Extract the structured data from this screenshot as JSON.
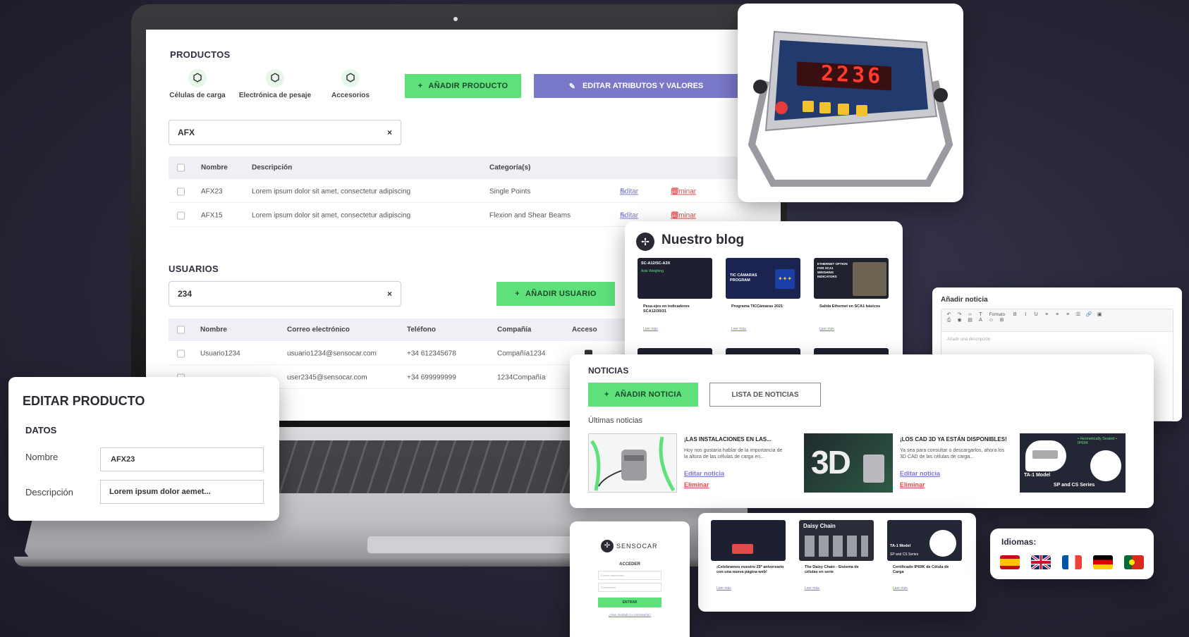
{
  "products": {
    "title": "PRODUCTOS",
    "categories": [
      "Células de carga",
      "Electrónica de pesaje",
      "Accesorios"
    ],
    "add_button": "AÑADIR PRODUCTO",
    "edit_attrs_button": "EDITAR ATRIBUTOS Y VALORES",
    "search_value": "AFX",
    "columns": [
      "Nombre",
      "Descripción",
      "Categoría(s)"
    ],
    "rows": [
      {
        "name": "AFX23",
        "description": "Lorem ipsum dolor sit amet, consectetur adipiscing",
        "category": "Single Points"
      },
      {
        "name": "AFX15",
        "description": "Lorem ipsum dolor sit amet, consectetur adipiscing",
        "category": "Flexion and Shear Beams"
      }
    ],
    "edit_label": "Editar",
    "delete_label": "Eliminar"
  },
  "users": {
    "title": "USUARIOS",
    "search_value": "234",
    "add_button": "AÑADIR USUARIO",
    "columns": [
      "Nombre",
      "Correo electrónico",
      "Teléfono",
      "Compañía",
      "Acceso"
    ],
    "rows": [
      {
        "name": "Usuario1234",
        "email": "usuario1234@sensocar.com",
        "phone": "+34 612345678",
        "company": "Compañía1234"
      },
      {
        "name": "",
        "email": "user2345@sensocar.com",
        "phone": "+34 699999999",
        "company": "1234Compañía"
      }
    ]
  },
  "edit_product": {
    "title": "EDITAR PRODUCTO",
    "section": "DATOS",
    "name_label": "Nombre",
    "name_value": "AFX23",
    "desc_label": "Descripción",
    "desc_value": "Lorem ipsum dolor aemet..."
  },
  "indicator": {
    "display": "2236"
  },
  "blog": {
    "title": "Nuestro blog",
    "posts": [
      {
        "thumb": "SC-A12/SC-A3X",
        "thumb_sub": "Axle Weighing",
        "title": "Pesa-ejes en indicadores SCA12/30/31",
        "more": "Leer más"
      },
      {
        "thumb": "TIC CÁMARAS PROGRAM",
        "title": "Programa TICCámaras 2021",
        "more": "Leer más"
      },
      {
        "thumb": "ETHERNET OPTION FOR SCA1 WEIGHING INDICATORS",
        "title": "Salida Ethernet en SCA1 básicos",
        "more": "Leer más"
      }
    ],
    "posts2": [
      {
        "thumb": "",
        "title": "¡Celebramos nuestro 25º aniversario con una nueva página web!",
        "more": "Leer más"
      },
      {
        "thumb": "Daisy Chain",
        "title": "The Daisy Chain - Sistema de células en serie",
        "more": "Leer más"
      },
      {
        "thumb": "TA-1 Model",
        "thumb_sub": "SP and CS Series",
        "title": "Certificado IP69K de Célula de Carga",
        "more": "Leer más"
      }
    ]
  },
  "add_news": {
    "title": "Añadir noticia",
    "format_label": "Formato",
    "placeholder": "Añadir una descripción"
  },
  "news": {
    "title": "NOTICIAS",
    "add_button": "AÑADIR NOTICIA",
    "list_button": "LISTA DE NOTICIAS",
    "latest_label": "Últimas noticias",
    "items": [
      {
        "title": "¡LAS INSTALACIONES EN LAS...",
        "text": "Hoy nos gustaría hablar de la importancia de la altura de las células de carga en...",
        "edit": "Editar noticia",
        "delete": "Eliminar"
      },
      {
        "title": "¡LOS CAD 3D YA ESTÁN DISPONIBLES!",
        "text": "Ya sea para consultar o descargarlos, ahora los 3D CAD de las células de carga...",
        "edit": "Editar noticia",
        "delete": "Eliminar"
      }
    ],
    "thumb2_text": "3D",
    "thumb3_model": "TA-1 Model",
    "thumb3_series": "SP and CS Series",
    "thumb3_badge": "• Hermetically Sealed • IP69K"
  },
  "login": {
    "brand": "SENSOCAR",
    "heading": "ACCEDER",
    "email_placeholder": "Correo electrónico",
    "password_placeholder": "Contraseña",
    "submit": "ENTRAR",
    "forgot": "¿Has olvidado tu contraseña?"
  },
  "languages": {
    "title": "Idiomas:",
    "flags": [
      "es-flag",
      "uk-flag",
      "fr-flag",
      "de-flag",
      "pt-flag"
    ]
  },
  "colors": {
    "accent_green": "#5ee07b",
    "accent_purple": "#7a78c8",
    "danger": "#e04a4a"
  }
}
